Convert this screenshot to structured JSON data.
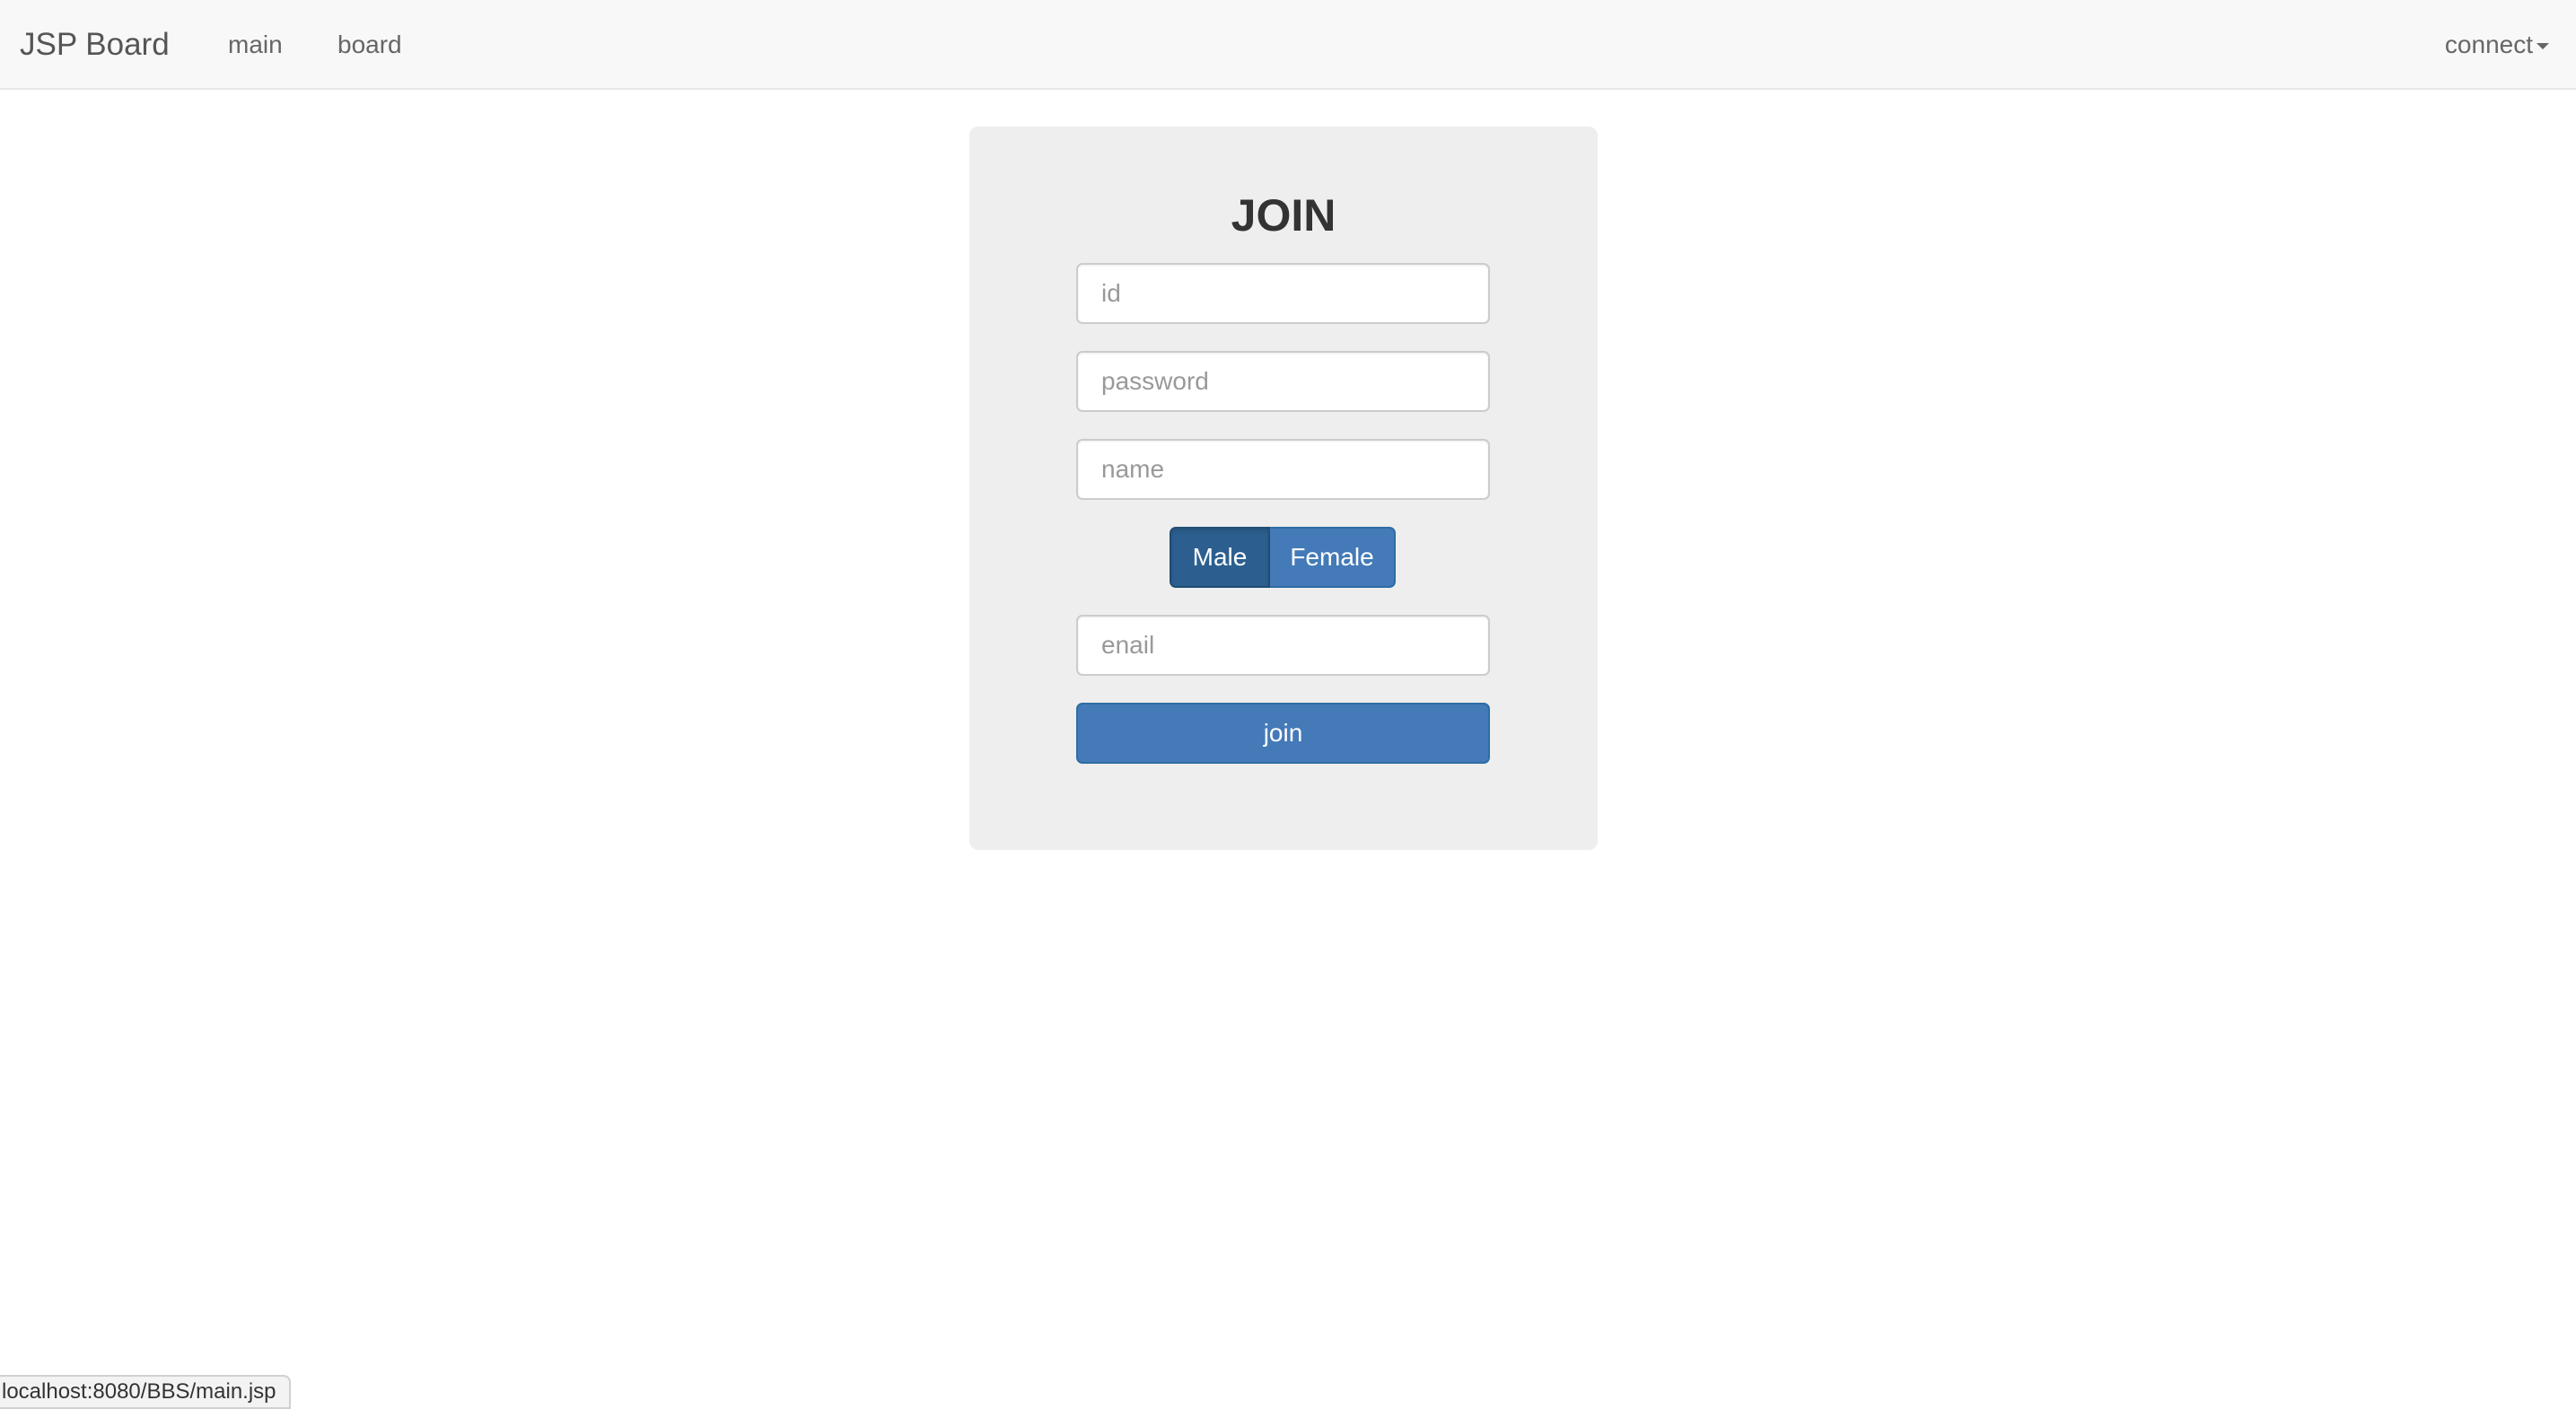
{
  "navbar": {
    "brand": "JSP Board",
    "links": [
      "main",
      "board"
    ],
    "dropdown_label": "connect"
  },
  "form": {
    "title": "JOIN",
    "id_placeholder": "id",
    "password_placeholder": "password",
    "name_placeholder": "name",
    "gender_options": [
      "Male",
      "Female"
    ],
    "gender_selected": "Male",
    "email_placeholder": "enail",
    "submit_label": "join"
  },
  "status_bar": {
    "url": "localhost:8080/BBS/main.jsp"
  },
  "colors": {
    "primary": "#447ab8",
    "primary_active": "#2c5f8f",
    "navbar_bg": "#f8f8f8",
    "panel_bg": "#eeeeee"
  }
}
